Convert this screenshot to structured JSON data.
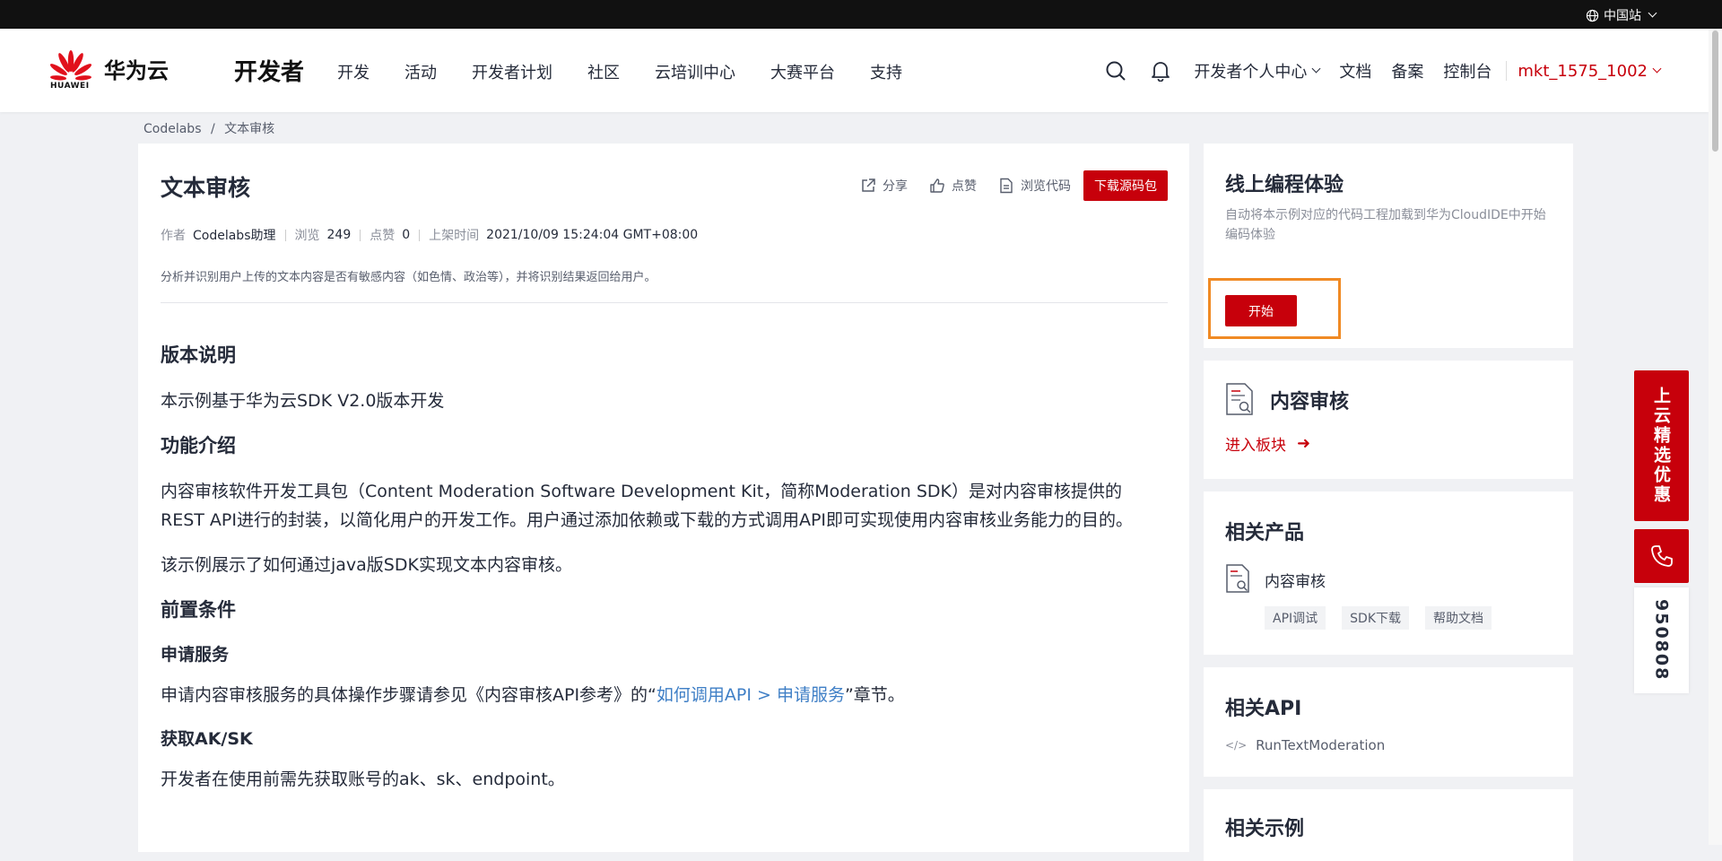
{
  "topbar": {
    "region_label": "中国站"
  },
  "header": {
    "logo_text": "华为云",
    "logo_sub": "HUAWEI",
    "section_title": "开发者",
    "nav": [
      "开发",
      "活动",
      "开发者计划",
      "社区",
      "云培训中心",
      "大赛平台",
      "支持"
    ],
    "personal_center": "开发者个人中心",
    "docs": "文档",
    "filing": "备案",
    "console": "控制台",
    "username": "mkt_1575_1002"
  },
  "breadcrumb": {
    "root": "Codelabs",
    "sep": "/",
    "current": "文本审核"
  },
  "article": {
    "title": "文本审核",
    "actions": {
      "share": "分享",
      "like": "点赞",
      "browse_code": "浏览代码",
      "download": "下载源码包"
    },
    "meta": {
      "author_label": "作者",
      "author": "Codelabs助理",
      "views_label": "浏览",
      "views": "249",
      "likes_label": "点赞",
      "likes": "0",
      "date_label": "上架时间",
      "date": "2021/10/09 15:24:04 GMT+08:00"
    },
    "summary": "分析并识别用户上传的文本内容是否有敏感内容（如色情、政治等），并将识别结果返回给用户。",
    "sections": {
      "version_heading": "版本说明",
      "version_text": "本示例基于华为云SDK V2.0版本开发",
      "feature_heading": "功能介绍",
      "feature_text1": "内容审核软件开发工具包（Content Moderation Software Development Kit，简称Moderation SDK）是对内容审核提供的REST API进行的封装，以简化用户的开发工作。用户通过添加依赖或下载的方式调用API即可实现使用内容审核业务能力的目的。",
      "feature_text2": "该示例展示了如何通过java版SDK实现文本内容审核。",
      "prereq_heading": "前置条件",
      "apply_heading": "申请服务",
      "apply_text_before": "申请内容审核服务的具体操作步骤请参见《内容审核API参考》的“",
      "apply_link": "如何调用API > 申请服务",
      "apply_text_after": "”章节。",
      "aksk_heading": "获取AK/SK",
      "aksk_text": "开发者在使用前需先获取账号的ak、sk、endpoint。"
    }
  },
  "sidebar": {
    "online": {
      "title": "线上编程体验",
      "desc": "自动将本示例对应的代码工程加载到华为CloudIDE中开始编码体验",
      "start": "开始"
    },
    "service": {
      "title": "内容审核",
      "enter": "进入板块",
      "arrow": "➜"
    },
    "products": {
      "title": "相关产品",
      "name": "内容审核",
      "tags": [
        "API调试",
        "SDK下载",
        "帮助文档"
      ]
    },
    "apis": {
      "title": "相关API",
      "code_icon": "</>",
      "item": "RunTextModeration"
    },
    "samples": {
      "title": "相关示例"
    }
  },
  "float": {
    "promo": "上云精选优惠",
    "hotline": "950808"
  },
  "colors": {
    "brand_red": "#c7000b",
    "highlight_orange": "#f08a24",
    "link_blue": "#3f7fc6"
  }
}
